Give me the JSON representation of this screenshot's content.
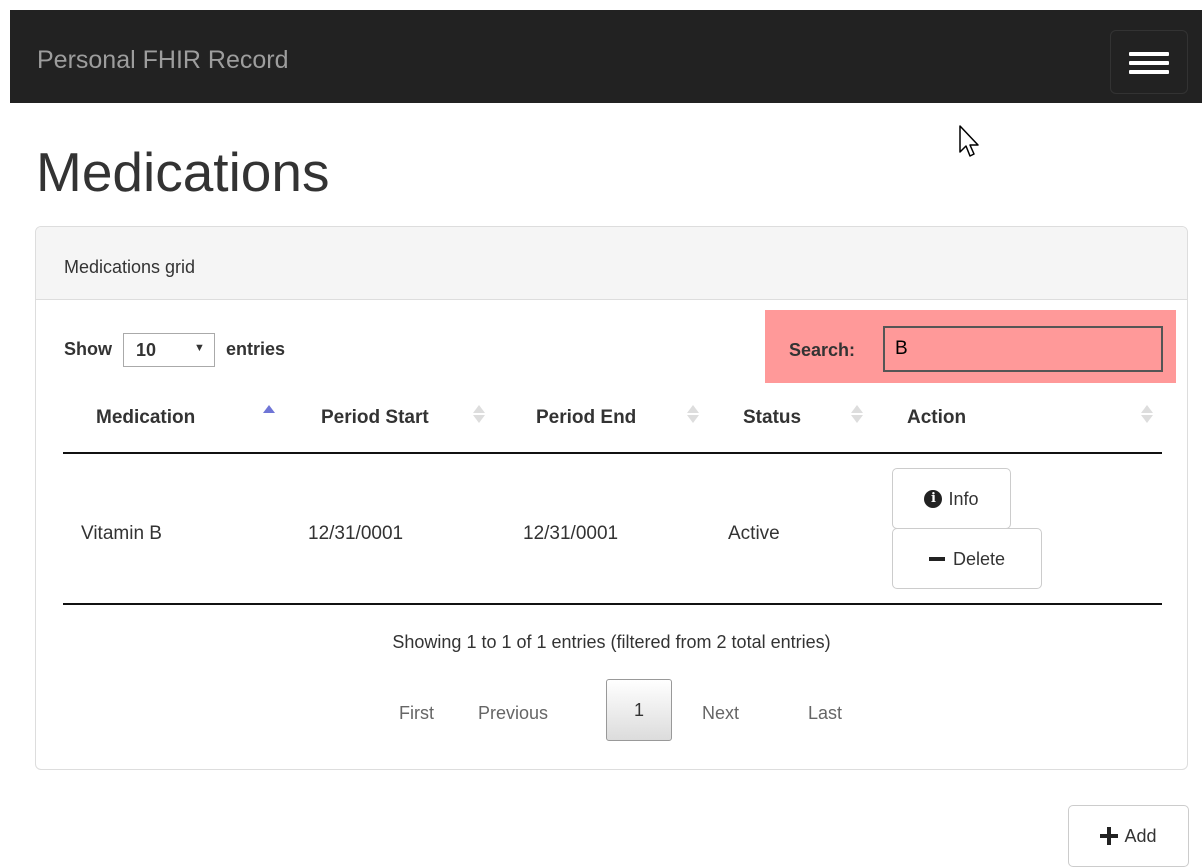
{
  "navbar": {
    "brand": "Personal FHIR Record",
    "menu_icon": "hamburger-icon"
  },
  "page": {
    "title": "Medications"
  },
  "panel": {
    "heading": "Medications grid",
    "length": {
      "show_label": "Show",
      "value": "10",
      "entries_label": "entries"
    },
    "search": {
      "label": "Search:",
      "value": "B",
      "highlight_color": "#ff9999"
    },
    "table": {
      "columns": [
        {
          "label": "Medication",
          "sort": "asc"
        },
        {
          "label": "Period Start",
          "sort": "none"
        },
        {
          "label": "Period End",
          "sort": "none"
        },
        {
          "label": "Status",
          "sort": "none"
        },
        {
          "label": "Action",
          "sort": "none"
        }
      ],
      "rows": [
        {
          "medication": "Vitamin B",
          "period_start": "12/31/0001",
          "period_end": "12/31/0001",
          "status": "Active",
          "actions": {
            "info": "Info",
            "delete": "Delete"
          }
        }
      ]
    },
    "info": "Showing 1 to 1 of 1 entries (filtered from 2 total entries)",
    "pagination": {
      "first": "First",
      "previous": "Previous",
      "current": "1",
      "next": "Next",
      "last": "Last"
    }
  },
  "add_button": {
    "label": "Add",
    "icon": "plus-icon"
  },
  "colors": {
    "navbar": "#222222",
    "sort_active": "#6f75d6"
  }
}
